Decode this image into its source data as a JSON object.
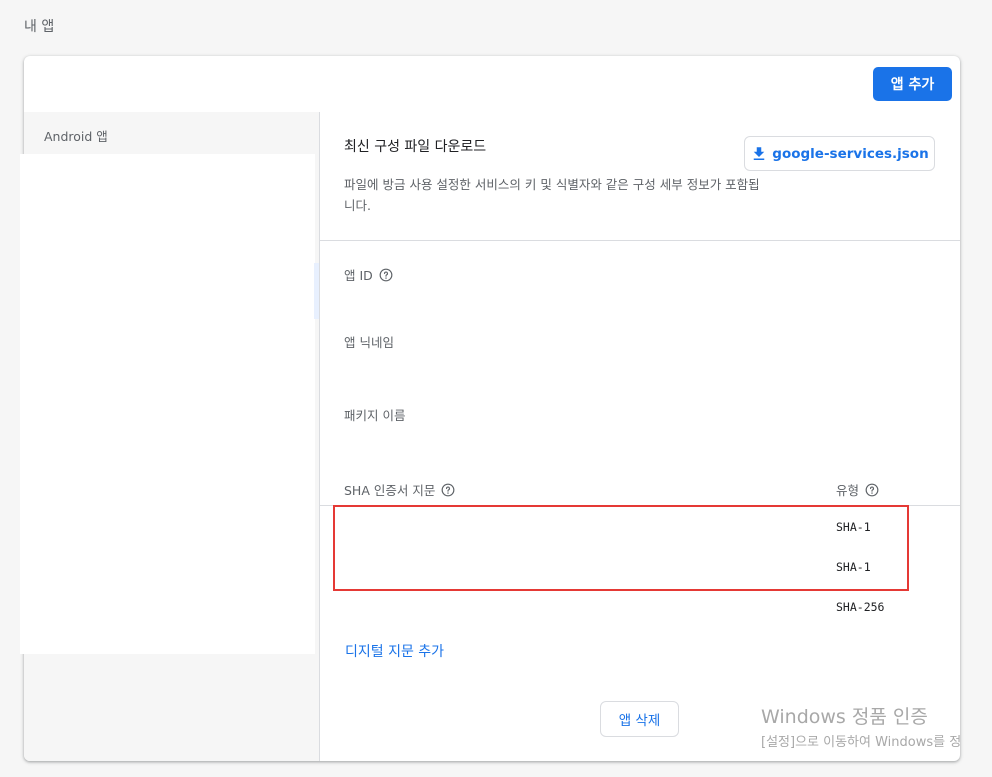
{
  "page": {
    "section_title": "내 앱"
  },
  "header": {
    "add_app_label": "앱 추가"
  },
  "sidebar": {
    "platform_label": "Android 앱"
  },
  "download": {
    "title": "최신 구성 파일 다운로드",
    "description": "파일에 방금 사용 설정한 서비스의 키 및 식별자와 같은 구성 세부 정보가 포함됩니다.",
    "button_label": "google-services.json"
  },
  "fields": {
    "app_id_label": "앱 ID",
    "nickname_label": "앱 닉네임",
    "package_name_label": "패키지 이름"
  },
  "fingerprints": {
    "header_label": "SHA 인증서 지문",
    "type_header": "유형",
    "rows": [
      {
        "type": "SHA-1"
      },
      {
        "type": "SHA-1"
      },
      {
        "type": "SHA-256"
      }
    ],
    "add_label": "디지털 지문 추가"
  },
  "actions": {
    "delete_label": "앱 삭제"
  },
  "watermark": {
    "line1": "Windows 정품 인증",
    "line2": "[설정]으로 이동하여 Windows를 정"
  },
  "colors": {
    "accent": "#1a73e8",
    "highlight": "#e53935"
  }
}
